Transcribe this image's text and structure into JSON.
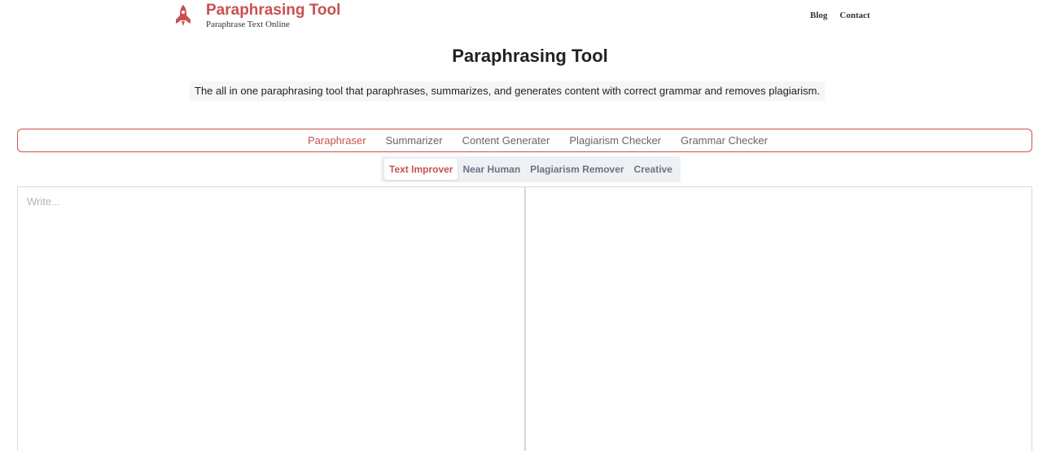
{
  "header": {
    "brand_title": "Paraphrasing Tool",
    "brand_subtitle": "Paraphrase Text Online",
    "nav": [
      "Blog",
      "Contact"
    ]
  },
  "hero": {
    "title": "Paraphrasing Tool",
    "description": "The all in one paraphrasing tool that paraphrases, summarizes, and generates content with correct grammar and removes plagiarism."
  },
  "tabs": [
    {
      "label": "Paraphraser",
      "active": true
    },
    {
      "label": "Summarizer",
      "active": false
    },
    {
      "label": "Content Generater",
      "active": false
    },
    {
      "label": "Plagiarism Checker",
      "active": false
    },
    {
      "label": "Grammar Checker",
      "active": false
    }
  ],
  "modes": [
    {
      "label": "Text Improver",
      "active": true
    },
    {
      "label": "Near Human",
      "active": false
    },
    {
      "label": "Plagiarism Remover",
      "active": false
    },
    {
      "label": "Creative",
      "active": false
    }
  ],
  "editor": {
    "input_placeholder": "Write...",
    "input_value": "",
    "output_value": ""
  },
  "colors": {
    "accent": "#c9514f",
    "mode_text": "#6a7384",
    "mode_bg": "#eef1f4"
  },
  "icons": {
    "logo": "rocket-icon"
  }
}
